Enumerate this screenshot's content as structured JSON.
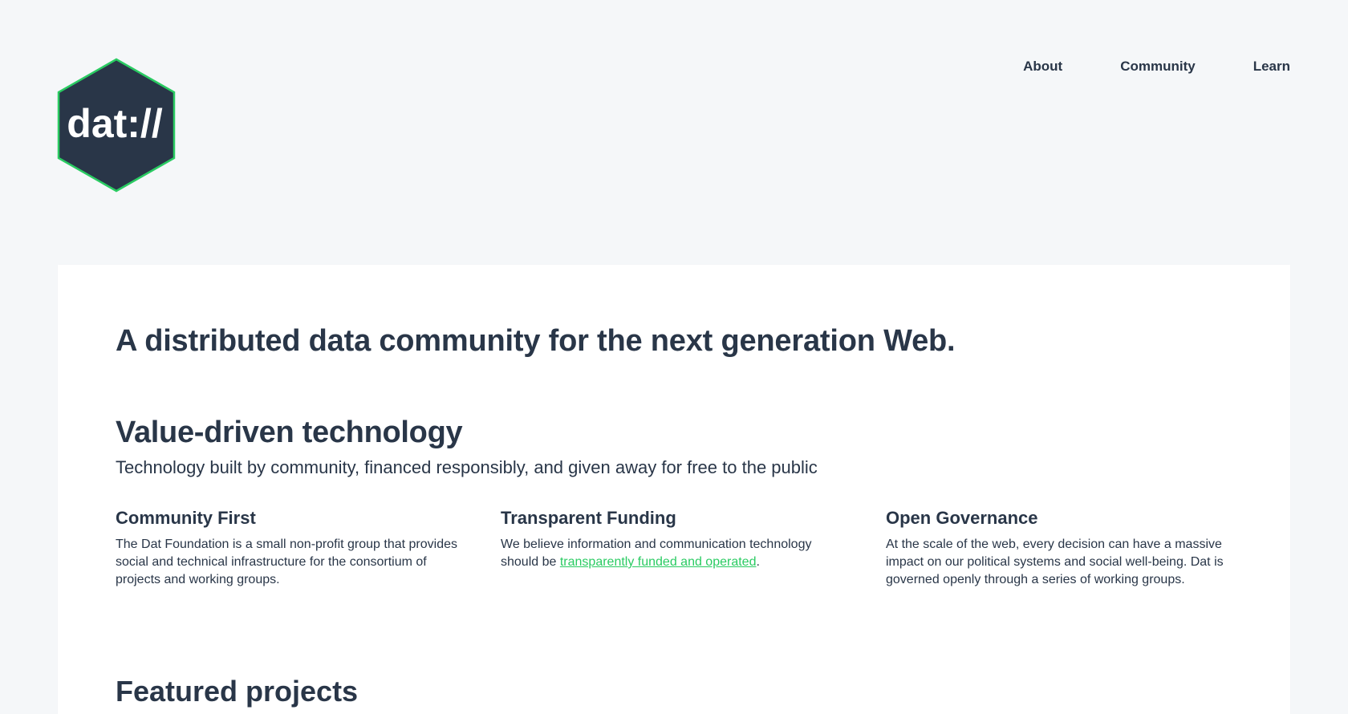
{
  "logo": {
    "text": "dat://",
    "fill_color": "#293648",
    "border_color": "#2acb62"
  },
  "nav": {
    "items": [
      "About",
      "Community",
      "Learn"
    ]
  },
  "main": {
    "tagline": "A distributed data community for the next generation Web.",
    "section": {
      "title": "Value-driven technology",
      "subtitle": "Technology built by community, financed responsibly, and given away for free to the public"
    },
    "features": [
      {
        "title": "Community First",
        "text": "The Dat Foundation is a small non-profit group that provides social and technical infrastructure for the consortium of projects and working groups."
      },
      {
        "title": "Transparent Funding",
        "text_before": "We believe information and communication technology should be ",
        "link": "transparently funded and operated",
        "text_after": "."
      },
      {
        "title": "Open Governance",
        "text": "At the scale of the web, every decision can have a massive impact on our political systems and social well-being. Dat is governed openly through a series of working groups."
      }
    ],
    "featured_title": "Featured projects"
  },
  "colors": {
    "background": "#f5f7f9",
    "text": "#293648",
    "accent": "#2acb62",
    "card": "#ffffff"
  }
}
